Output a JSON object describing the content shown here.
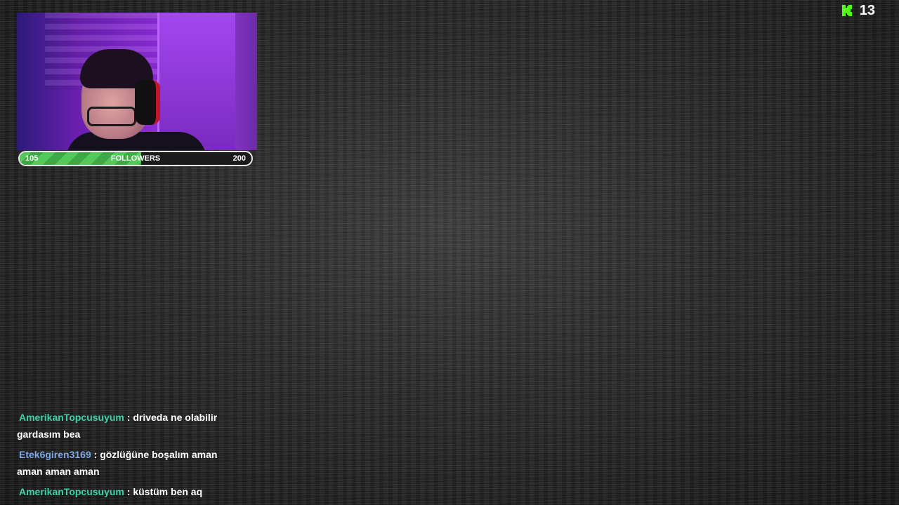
{
  "stream": {
    "viewer_count": "13",
    "platform_icon": "kick-logo-icon",
    "accent_color": "#53fc18"
  },
  "goal": {
    "current": "105",
    "label": "FOLLOWERS",
    "target": "200",
    "progress_fraction": 0.525,
    "fill_color": "#53c95a"
  },
  "chat": {
    "messages": [
      {
        "user": "AmerikanTopcusuyum",
        "separator": " : ",
        "text": "driveda ne olabilir gardasım bea",
        "color": "#3fd1a8"
      },
      {
        "user": "Etek6giren3169",
        "separator": " : ",
        "text": "gözlüğüne boşalım aman aman aman aman",
        "color": "#7ea8e6"
      },
      {
        "user": "AmerikanTopcusuyum",
        "separator": " : ",
        "text": "küstüm ben aq",
        "color": "#3fd1a8"
      }
    ]
  }
}
